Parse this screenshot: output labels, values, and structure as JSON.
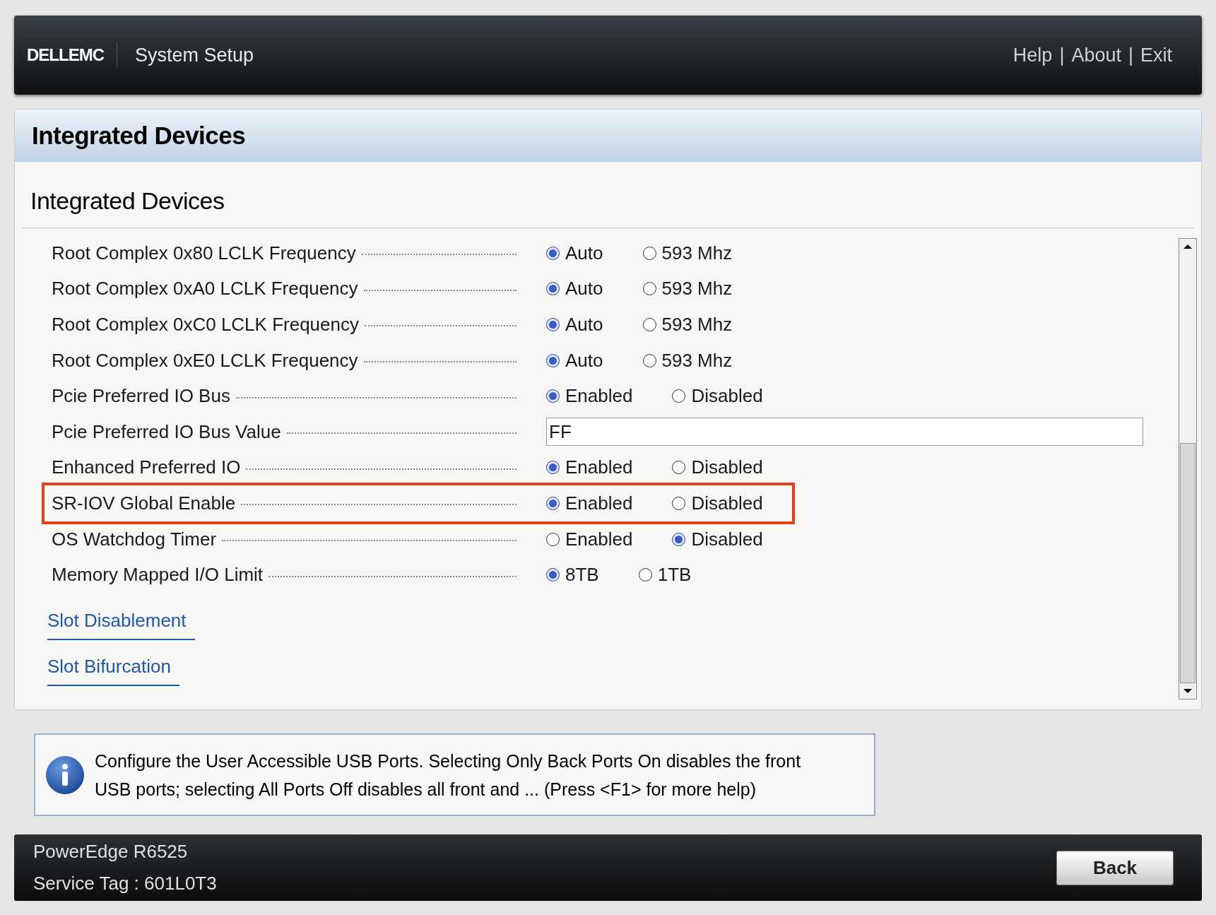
{
  "header": {
    "logo": "DELLEMC",
    "title": "System Setup",
    "links": [
      {
        "label": "Help"
      },
      {
        "label": "About"
      },
      {
        "label": "Exit"
      }
    ],
    "separator": "|"
  },
  "page": {
    "title": "Integrated Devices",
    "section_title": "Integrated Devices",
    "settings": [
      {
        "kind": "radio",
        "label": "Root Complex 0x80 LCLK Frequency",
        "highlighted": false,
        "options": [
          {
            "label": "Auto",
            "selected": true
          },
          {
            "label": "593 Mhz",
            "selected": false
          }
        ]
      },
      {
        "kind": "radio",
        "label": "Root Complex 0xA0 LCLK Frequency",
        "highlighted": false,
        "options": [
          {
            "label": "Auto",
            "selected": true
          },
          {
            "label": "593 Mhz",
            "selected": false
          }
        ]
      },
      {
        "kind": "radio",
        "label": "Root Complex 0xC0 LCLK Frequency",
        "highlighted": false,
        "options": [
          {
            "label": "Auto",
            "selected": true
          },
          {
            "label": "593 Mhz",
            "selected": false
          }
        ]
      },
      {
        "kind": "radio",
        "label": "Root Complex 0xE0 LCLK Frequency",
        "highlighted": false,
        "options": [
          {
            "label": "Auto",
            "selected": true
          },
          {
            "label": "593 Mhz",
            "selected": false
          }
        ]
      },
      {
        "kind": "radio",
        "label": "Pcie Preferred IO Bus",
        "highlighted": false,
        "options": [
          {
            "label": "Enabled",
            "selected": true
          },
          {
            "label": "Disabled",
            "selected": false
          }
        ]
      },
      {
        "kind": "text",
        "label": "Pcie Preferred IO Bus Value",
        "highlighted": false,
        "value": "FF"
      },
      {
        "kind": "radio",
        "label": "Enhanced Preferred IO",
        "highlighted": false,
        "options": [
          {
            "label": "Enabled",
            "selected": true
          },
          {
            "label": "Disabled",
            "selected": false
          }
        ]
      },
      {
        "kind": "radio",
        "label": "SR-IOV Global Enable",
        "highlighted": true,
        "options": [
          {
            "label": "Enabled",
            "selected": true
          },
          {
            "label": "Disabled",
            "selected": false
          }
        ]
      },
      {
        "kind": "radio",
        "label": "OS Watchdog Timer",
        "highlighted": false,
        "options": [
          {
            "label": "Enabled",
            "selected": false
          },
          {
            "label": "Disabled",
            "selected": true
          }
        ]
      },
      {
        "kind": "radio",
        "label": "Memory Mapped I/O Limit",
        "highlighted": false,
        "options": [
          {
            "label": "8TB",
            "selected": true
          },
          {
            "label": "1TB",
            "selected": false
          }
        ]
      }
    ],
    "links": [
      "Slot Disablement",
      "Slot Bifurcation"
    ]
  },
  "help_box": {
    "text": "Configure the User Accessible USB Ports. Selecting Only Back Ports On disables the front USB ports; selecting All Ports Off disables all front and ... (Press <F1> for more help)"
  },
  "footer": {
    "model": "PowerEdge R6525",
    "service_tag": "Service Tag : 601L0T3",
    "back_button": "Back"
  }
}
